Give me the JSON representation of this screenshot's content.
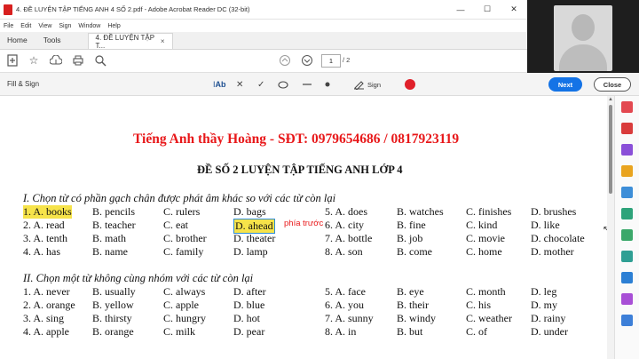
{
  "window": {
    "title": "4. ĐỀ LUYỆN TẬP TIẾNG ANH 4 SỐ 2.pdf - Adobe Acrobat Reader DC (32-bit)",
    "minimize": "—",
    "maximize": "☐",
    "close": "✕"
  },
  "menu": [
    "File",
    "Edit",
    "View",
    "Sign",
    "Window",
    "Help"
  ],
  "tabs": {
    "home": "Home",
    "tools": "Tools",
    "doc": "4. ĐỀ LUYỆN TẬP T...",
    "doc_close": "×"
  },
  "toolbar": {
    "page_current": "1",
    "page_total": "/ 2"
  },
  "fillsign": {
    "label": "Fill & Sign",
    "text_tool": "Ab",
    "sign": "Sign",
    "next": "Next",
    "close": "Close",
    "active_color": "#e0202a"
  },
  "document": {
    "header": "Tiếng Anh thầy Hoàng - SĐT: 0979654686 / 0817923119",
    "title": "ĐỀ SỐ 2 LUYỆN TẬP TIẾNG ANH LỚP 4",
    "annotation": "phía trước",
    "section1": {
      "title": "I. Chọn từ có phần gạch chân được phát âm khác so với các từ còn lại",
      "rows": [
        [
          "1. A. books",
          "B. pencils",
          "C. rulers",
          "D. bags",
          "5. A. does",
          "B. watches",
          "C. finishes",
          "D. brushes"
        ],
        [
          "2. A. read",
          "B. teacher",
          "C. eat",
          "D. ahead",
          "6. A. city",
          "B. fine",
          "C. kind",
          "D. like"
        ],
        [
          "3. A. tenth",
          "B. math",
          "C. brother",
          "D. theater",
          "7. A. bottle",
          "B. job",
          "C. movie",
          "D. chocolate"
        ],
        [
          "4. A. has",
          "B. name",
          "C. family",
          "D. lamp",
          "8. A. son",
          "B. come",
          "C. home",
          "D. mother"
        ]
      ]
    },
    "section2": {
      "title": "II. Chọn một từ không cùng nhóm với các từ còn lại",
      "rows": [
        [
          "1. A. never",
          "B. usually",
          "C. always",
          "D. after",
          "5. A. face",
          "B. eye",
          "C. month",
          "D. leg"
        ],
        [
          "2. A. orange",
          "B. yellow",
          "C. apple",
          "D. blue",
          "6. A. you",
          "B. their",
          "C. his",
          "D. my"
        ],
        [
          "3. A. sing",
          "B. thirsty",
          "C. hungry",
          "D. hot",
          "7. A. sunny",
          "B. windy",
          "C. weather",
          "D. rainy"
        ],
        [
          "4. A. apple",
          "B. orange",
          "C. milk",
          "D. pear",
          "8. A. in",
          "B. but",
          "C. of",
          "D. under"
        ]
      ]
    }
  }
}
